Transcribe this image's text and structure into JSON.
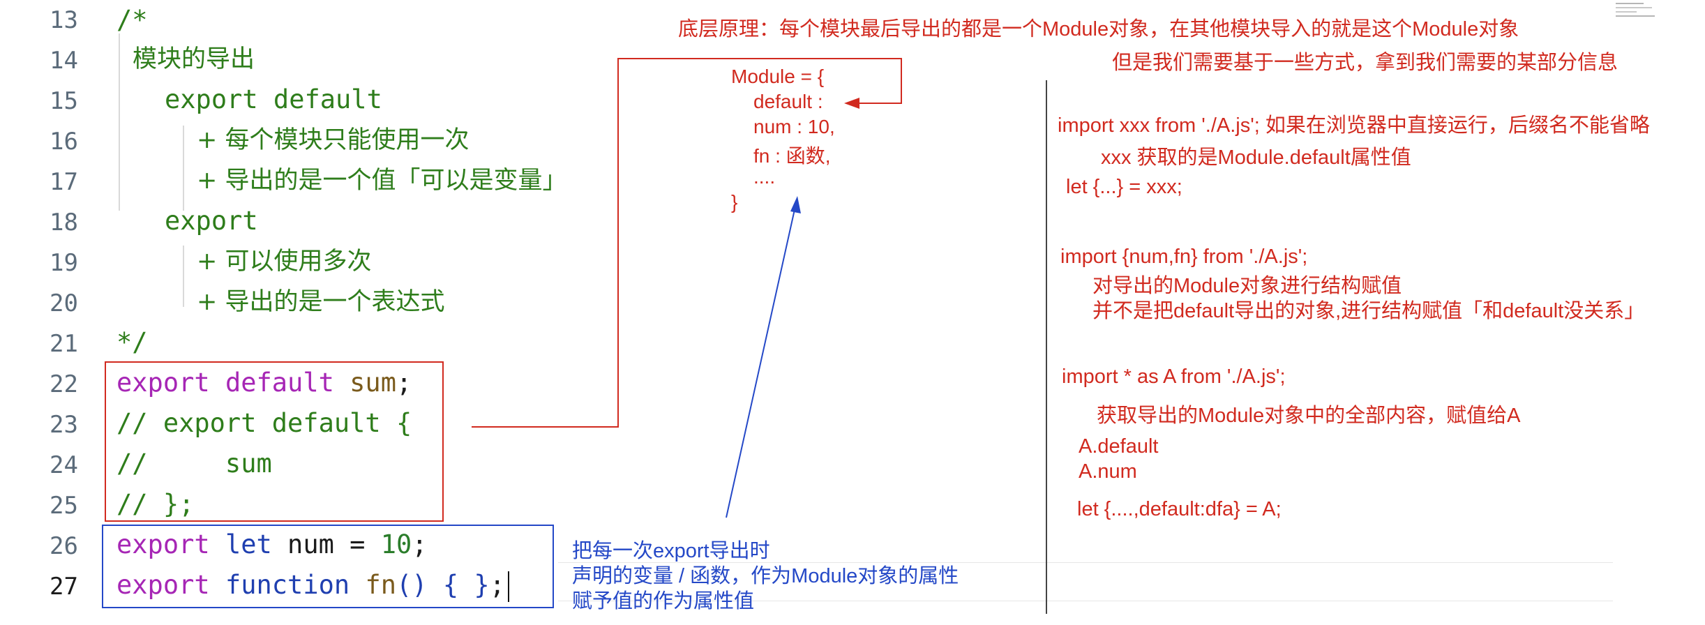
{
  "editor": {
    "line_numbers": [
      "13",
      "14",
      "15",
      "16",
      "17",
      "18",
      "19",
      "20",
      "21",
      "22",
      "23",
      "24",
      "25",
      "26",
      "27"
    ],
    "comment": {
      "open": "/*",
      "l14": "模块的导出",
      "l15": "export default",
      "l16": "+ 每个模块只能使用一次",
      "l17": "+ 导出的是一个值「可以是变量」",
      "l18": "export",
      "l19": "+ 可以使用多次",
      "l20": "+ 导出的是一个表达式",
      "close": "*/"
    },
    "l22": {
      "kw": "export",
      "kw2": "default",
      "ident": "sum",
      "end": ";"
    },
    "l23": "// export default {",
    "l24": "//     sum",
    "l25": "// };",
    "l26": {
      "kw": "export",
      "kw2": "let",
      "ident": "num",
      "op": " = ",
      "num": "10",
      "end": ";"
    },
    "l27": {
      "kw": "export",
      "kw2": "function",
      "ident": "fn",
      "paren": "()",
      "body": "{ }",
      "end": ";"
    }
  },
  "annotations": {
    "top_line1": "底层原理：每个模块最后导出的都是一个Module对象，在其他模块导入的就是这个Module对象",
    "top_line2": "但是我们需要基于一些方式，拿到我们需要的某部分信息",
    "module_obj": [
      "Module = {",
      "default :",
      "num : 10,",
      "fn : 函数,",
      "....",
      "}"
    ],
    "blue_note": [
      "把每一次export导出时",
      "声明的变量 / 函数，作为Module对象的属性",
      "赋予值的作为属性值"
    ],
    "right": {
      "imp1": "import xxx from './A.js';   如果在浏览器中直接运行，后缀名不能省略",
      "imp1_note": "xxx 获取的是Module.default属性值",
      "imp1_let": "let {...} = xxx;",
      "imp2": "import {num,fn} from './A.js';",
      "imp2_note1": "对导出的Module对象进行结构赋值",
      "imp2_note2": "并不是把default导出的对象,进行结构赋值「和default没关系」",
      "imp3": "import * as A from './A.js';",
      "imp3_note": "获取导出的Module对象中的全部内容，赋值给A",
      "imp3_a1": "A.default",
      "imp3_a2": "A.num",
      "imp3_let": "let {....,default:dfa} = A;"
    }
  },
  "colors": {
    "red": "#d12a1f",
    "blue": "#2448c7",
    "comment": "#2e7d1b",
    "keyword": "#a626b5"
  }
}
